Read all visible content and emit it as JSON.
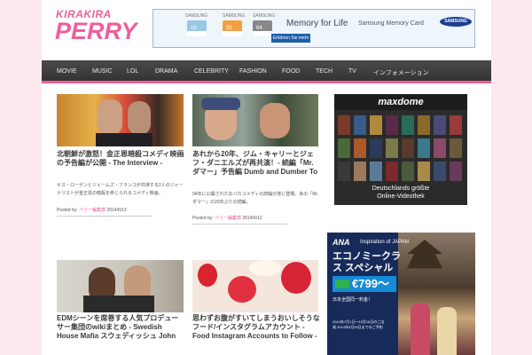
{
  "logo": {
    "line1": "KIRAKIRA",
    "line2": "PERRY"
  },
  "top_ad": {
    "cards": [
      "16",
      "32",
      "64"
    ],
    "card_brand": "SAMSUNG",
    "headline": "Memory for Life",
    "product": "Samsung Memory Card",
    "cta": "Erfahren Sie mehr",
    "brand": "SAMSUNG"
  },
  "nav": [
    "MOVIE",
    "MUSIC",
    "LOL",
    "DRAMA",
    "CELEBRITY",
    "FASHION",
    "FOOD",
    "TECH",
    "TV",
    "インフォメーション"
  ],
  "posts": [
    {
      "title": "北朝鮮が激怒！金正恩暗殺コメディ映画の予告編が公開 - The Interview -",
      "excerpt": "セス・ローゲンとジェームズ・フランコが共演する2人のジャーナリストが金正恩の暗殺を命じられるコメディ映画。",
      "meta_prefix": "Posted by:",
      "author": "ペリー編集部",
      "date": "2014/6/13"
    },
    {
      "title": "あれから20年、ジム・キャリーとジェフ・ダニエルズが再共演！- 続編「Mr.ダマー」予告編 Dumb and Dumber To",
      "excerpt": "94年に公開されたおバカコメディの続編が遂に登場。あの「Mr.ダマー」の20年ぶりの続編。",
      "meta_prefix": "Posted by:",
      "author": "ペリー編集部",
      "date": "2014/6/12"
    },
    {
      "title": "EDMシーンを席巻する人気プロデューサー集団のwikiまとめ - Swedish House Mafia スウェディッシュ John",
      "excerpt": "",
      "meta_prefix": "",
      "author": "",
      "date": ""
    },
    {
      "title": "思わずお腹がすいてしまうおいしそうなフード/インスタグラムアカウント - Food Instagram Accounts to Follow -",
      "excerpt": "",
      "meta_prefix": "",
      "author": "",
      "date": ""
    }
  ],
  "side_ad": {
    "brand": "maxdome",
    "tagline_1": "Deutschlands größte",
    "tagline_2": "Online-Videothek"
  },
  "ana_ad": {
    "brand": "ANA",
    "inspiration": "Inspiration of JAPAN",
    "headline": "エコノミークラス スペシャル",
    "price": "€799～",
    "sub": "日本全国同一料金！",
    "note": "2014年7月1日～12月16日のご出発 2014年5月20日までのご予約"
  },
  "colors": {
    "accent": "#ee5f9a",
    "nav_bg": "#3b3b3b",
    "page_bg": "#fbe9ee"
  }
}
